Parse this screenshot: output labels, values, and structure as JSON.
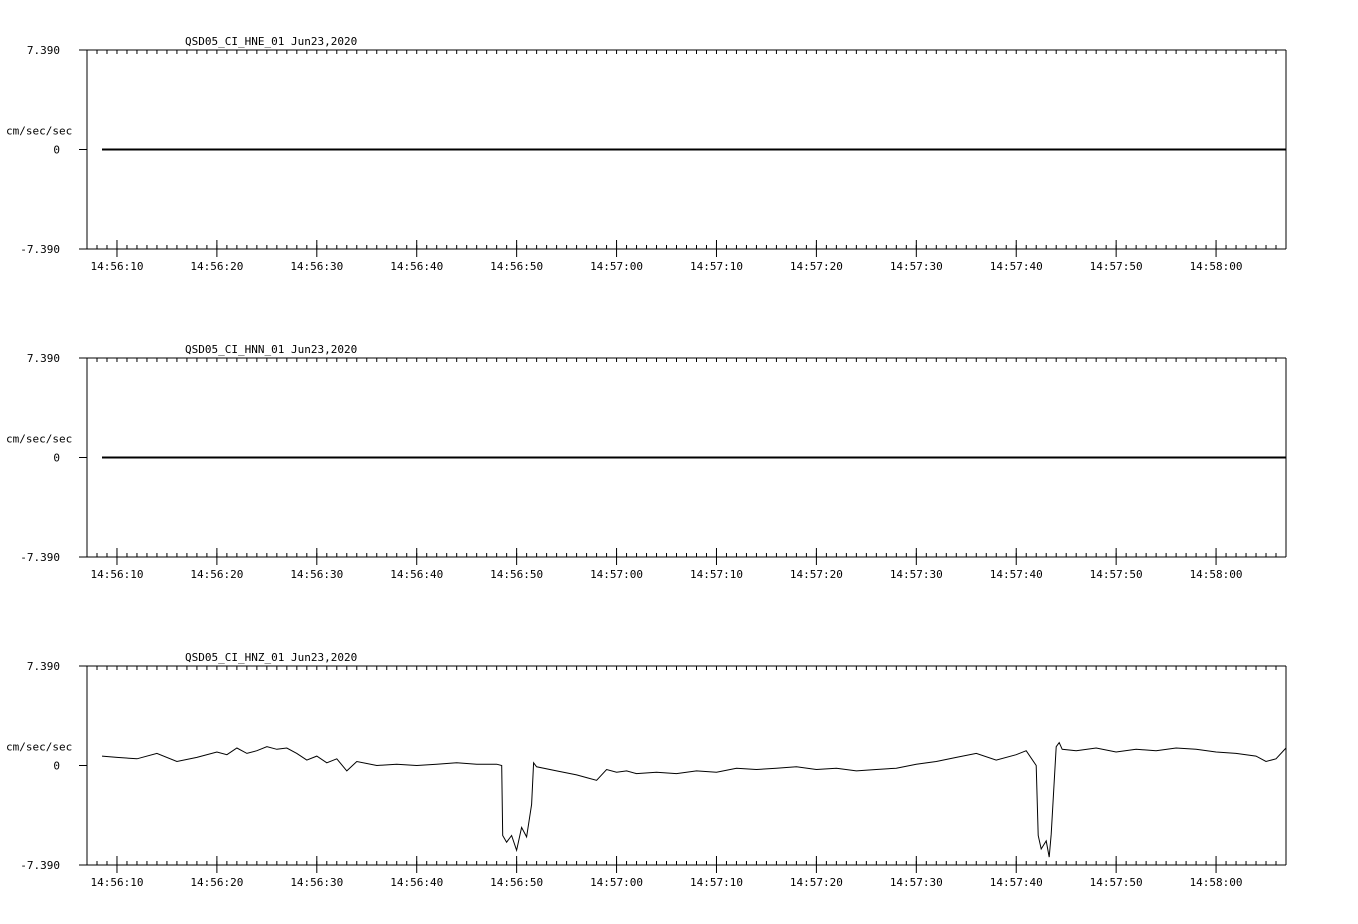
{
  "chart_data": [
    {
      "type": "line",
      "title": "QSD05_CI_HNE_01  Jun23,2020",
      "ylabel": "cm/sec/sec",
      "ytick_labels": [
        "7.390",
        "0",
        "-7.390"
      ],
      "ylim": [
        -7.39,
        7.39
      ],
      "xlim": [
        7,
        67.7
      ],
      "x_tick_labels": [
        "14:56:10",
        "14:56:20",
        "14:56:30",
        "14:56:40",
        "14:56:50",
        "14:57:00",
        "14:57:10",
        "14:57:20",
        "14:57:30",
        "14:57:40",
        "14:57:50",
        "14:58:00"
      ],
      "x_tick_values": [
        10,
        20,
        30,
        40,
        50,
        60,
        70,
        80,
        90,
        100,
        110,
        120
      ],
      "series": [
        {
          "x": [
            8.5,
            127.0
          ],
          "values": [
            0,
            0
          ]
        }
      ]
    },
    {
      "type": "line",
      "title": "QSD05_CI_HNN_01  Jun23,2020",
      "ylabel": "cm/sec/sec",
      "ytick_labels": [
        "7.390",
        "0",
        "-7.390"
      ],
      "ylim": [
        -7.39,
        7.39
      ],
      "xlim": [
        7,
        127
      ],
      "x_tick_labels": [
        "14:56:10",
        "14:56:20",
        "14:56:30",
        "14:56:40",
        "14:56:50",
        "14:57:00",
        "14:57:10",
        "14:57:20",
        "14:57:30",
        "14:57:40",
        "14:57:50",
        "14:58:00"
      ],
      "x_tick_values": [
        10,
        20,
        30,
        40,
        50,
        60,
        70,
        80,
        90,
        100,
        110,
        120
      ],
      "series": [
        {
          "x": [
            8.5,
            127.0
          ],
          "values": [
            0,
            0
          ]
        }
      ]
    },
    {
      "type": "line",
      "title": "QSD05_CI_HNZ_01  Jun23,2020",
      "ylabel": "cm/sec/sec",
      "ytick_labels": [
        "7.390",
        "0",
        "-7.390"
      ],
      "ylim": [
        -7.39,
        7.39
      ],
      "xlim": [
        7,
        127
      ],
      "x_tick_labels": [
        "14:56:10",
        "14:56:20",
        "14:56:30",
        "14:56:40",
        "14:56:50",
        "14:57:00",
        "14:57:10",
        "14:57:20",
        "14:57:30",
        "14:57:40",
        "14:57:50",
        "14:58:00"
      ],
      "x_tick_values": [
        10,
        20,
        30,
        40,
        50,
        60,
        70,
        80,
        90,
        100,
        110,
        120
      ],
      "series": [
        {
          "x": [
            8.5,
            10,
            12,
            14,
            16,
            18,
            20,
            21,
            22,
            23,
            24,
            25,
            26,
            27,
            28,
            29,
            30,
            31,
            32,
            33,
            34,
            36,
            38,
            40,
            42,
            44,
            46,
            48,
            48.5,
            48.6,
            49,
            49.5,
            50,
            50.5,
            51,
            51.5,
            51.7,
            52,
            54,
            56,
            57,
            58,
            59,
            60,
            61,
            62,
            64,
            66,
            68,
            70,
            72,
            74,
            76,
            78,
            80,
            82,
            84,
            86,
            88,
            90,
            92,
            94,
            96,
            98,
            100,
            101,
            102,
            102.2,
            102.5,
            103,
            103.3,
            103.5,
            104,
            104.3,
            104.6,
            106,
            108,
            110,
            112,
            114,
            116,
            118,
            120,
            122,
            124,
            125,
            126,
            127
          ],
          "values": [
            0.7,
            0.6,
            0.5,
            0.9,
            0.3,
            0.6,
            1.0,
            0.8,
            1.3,
            0.9,
            1.1,
            1.4,
            1.2,
            1.3,
            0.9,
            0.4,
            0.7,
            0.2,
            0.5,
            -0.4,
            0.3,
            0.0,
            0.1,
            0.0,
            0.1,
            0.2,
            0.1,
            0.1,
            0.0,
            -5.2,
            -5.7,
            -5.2,
            -6.3,
            -4.6,
            -5.3,
            -2.9,
            0.2,
            -0.1,
            -0.4,
            -0.7,
            -0.9,
            -1.1,
            -0.3,
            -0.5,
            -0.4,
            -0.6,
            -0.5,
            -0.6,
            -0.4,
            -0.5,
            -0.2,
            -0.3,
            -0.2,
            -0.1,
            -0.3,
            -0.2,
            -0.4,
            -0.3,
            -0.2,
            0.1,
            0.3,
            0.6,
            0.9,
            0.4,
            0.8,
            1.1,
            0.0,
            -5.2,
            -6.2,
            -5.6,
            -6.8,
            -5.1,
            1.4,
            1.7,
            1.2,
            1.1,
            1.3,
            1.0,
            1.2,
            1.1,
            1.3,
            1.2,
            1.0,
            0.9,
            0.7,
            0.3,
            0.5,
            1.3
          ]
        }
      ]
    }
  ]
}
